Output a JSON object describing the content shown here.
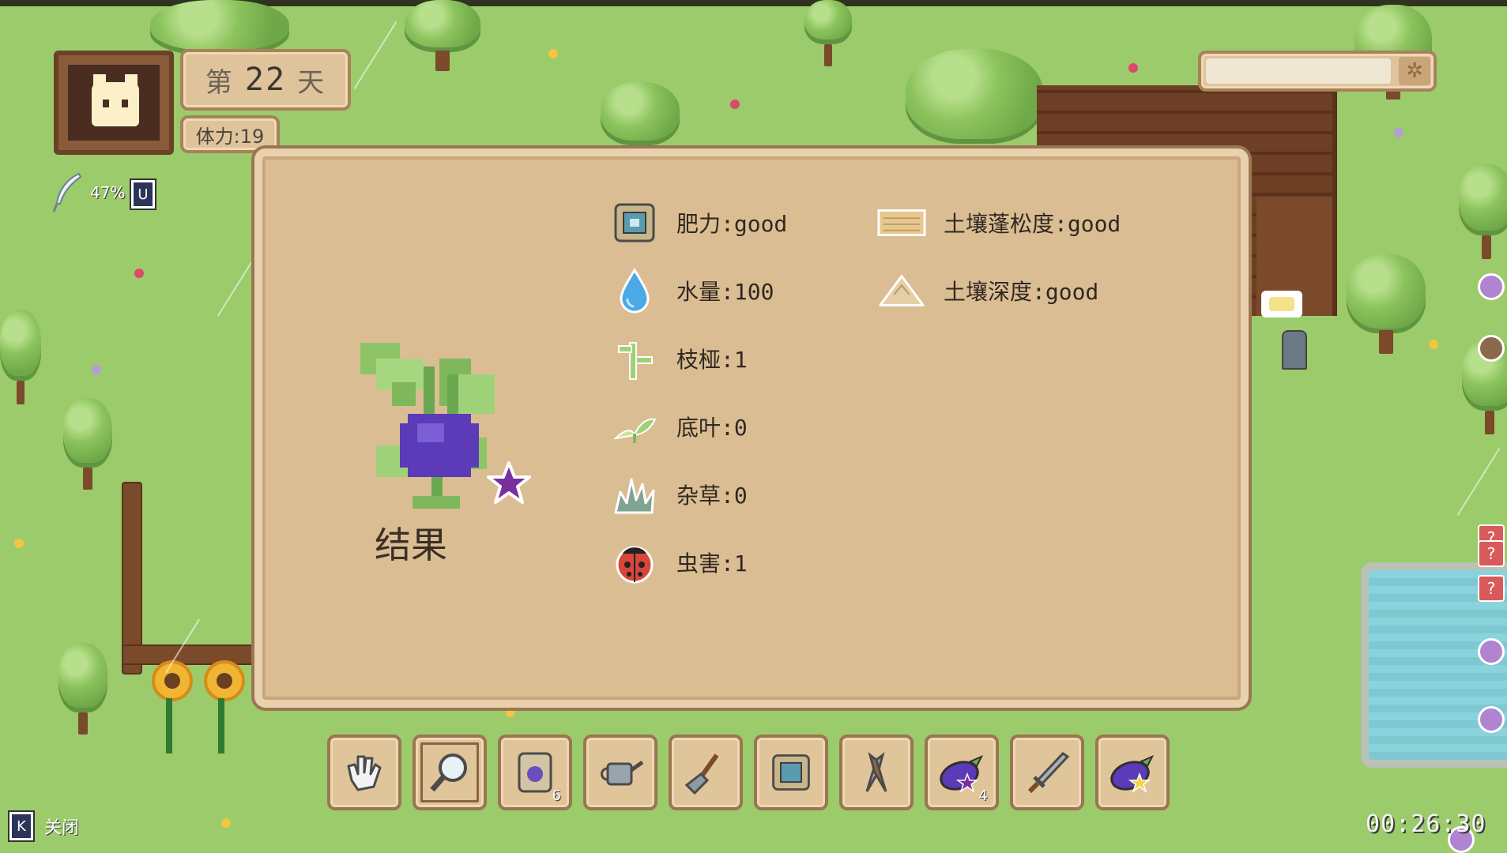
{
  "hud": {
    "day_prefix": "第",
    "day_number": "22",
    "day_suffix": "天",
    "stamina": "体力:19",
    "feather_percent": "47%",
    "key_hint_u": "U",
    "top_bar_icon": "gear-icon"
  },
  "dialog": {
    "result_label": "结果",
    "stats_left": [
      {
        "icon": "fertilizer-bag-icon",
        "text": "肥力:good"
      },
      {
        "icon": "water-drop-icon",
        "text": "水量:100"
      },
      {
        "icon": "branch-icon",
        "text": "枝桠:1"
      },
      {
        "icon": "bottom-leaf-icon",
        "text": "底叶:0"
      },
      {
        "icon": "weed-icon",
        "text": "杂草:0"
      },
      {
        "icon": "ladybug-icon",
        "text": "虫害:1"
      }
    ],
    "stats_right": [
      {
        "icon": "soil-tiles-icon",
        "text": "土壤蓬松度:good"
      },
      {
        "icon": "soil-mound-icon",
        "text": "土壤深度:good"
      }
    ]
  },
  "hotbar": {
    "slots": [
      {
        "icon": "glove-icon",
        "count": ""
      },
      {
        "icon": "magnifier-icon",
        "count": "",
        "selected": true
      },
      {
        "icon": "seed-bag-icon",
        "count": "6"
      },
      {
        "icon": "watering-can-icon",
        "count": ""
      },
      {
        "icon": "shovel-icon",
        "count": ""
      },
      {
        "icon": "fertilizer-bag-icon",
        "count": ""
      },
      {
        "icon": "shears-icon",
        "count": ""
      },
      {
        "icon": "eggplant-icon",
        "count": "4"
      },
      {
        "icon": "sword-icon",
        "count": ""
      },
      {
        "icon": "eggplant-gold-icon",
        "count": ""
      }
    ]
  },
  "footer": {
    "close_key": "K",
    "close_label": "关闭",
    "clock": "00:26:30"
  },
  "colors": {
    "panel": "#dbbd93",
    "panel_border": "#9a7652",
    "grass": "#9ccb6b",
    "eggplant": "#5b3bb8",
    "star": "#7a2f9e"
  }
}
